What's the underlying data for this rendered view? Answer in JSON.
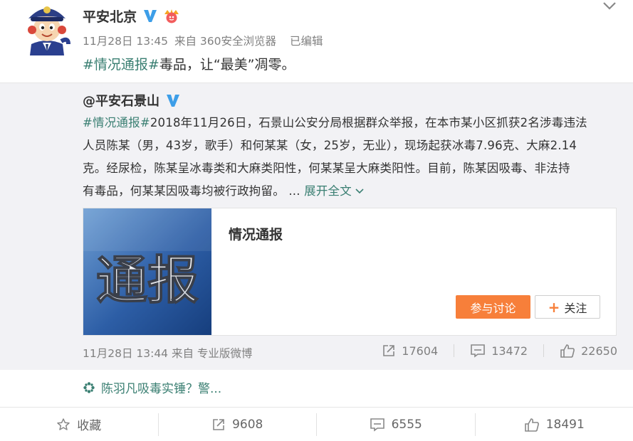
{
  "post": {
    "author": "平安北京",
    "date": "11月28日 13:45",
    "source": "来自 360安全浏览器",
    "edited": "已编辑",
    "hashtag": "#情况通报#",
    "text": "毒品，让“最美”凋零。"
  },
  "repost": {
    "author": "@平安石景山",
    "hashtag": "#情况通报#",
    "lines": [
      "2018年11月26日，石景山公安分局根据群众举报，在本市某小区抓获2名涉毒违法",
      "人员陈某（男，43岁，歌手）和何某某（女，25岁，无业），现场起获冰毒7.96克、大麻2.14",
      "克。经尿检，陈某呈冰毒类和大麻类阳性，何某某呈大麻类阳性。目前，陈某因吸毒、非法持",
      "有毒品，何某某因吸毒均被行政拘留。 ..."
    ],
    "expand_label": "展开全文",
    "card": {
      "thumb_text": "通报",
      "title": "情况通报",
      "discuss_label": "参与讨论",
      "follow_label": "关注"
    },
    "date": "11月28日 13:44",
    "source": "来自 专业版微博",
    "stats": {
      "reposts": "17604",
      "comments": "13472",
      "likes": "22650"
    }
  },
  "topic": {
    "text": "陈羽凡吸毒实锤？警..."
  },
  "footer": {
    "favorite_label": "收藏",
    "repost_count": "9608",
    "comment_count": "6555",
    "like_count": "18491"
  },
  "colors": {
    "accent_green": "#3a7f72",
    "verified_blue": "#3d9ee8",
    "orange": "#f77f3a",
    "repost_bg": "#f2f2f5"
  },
  "icons": [
    "police-avatar",
    "verified-icon",
    "crown-badge-icon",
    "chevron-down-icon",
    "repost-icon",
    "comment-icon",
    "like-icon",
    "star-icon",
    "topic-icon"
  ]
}
